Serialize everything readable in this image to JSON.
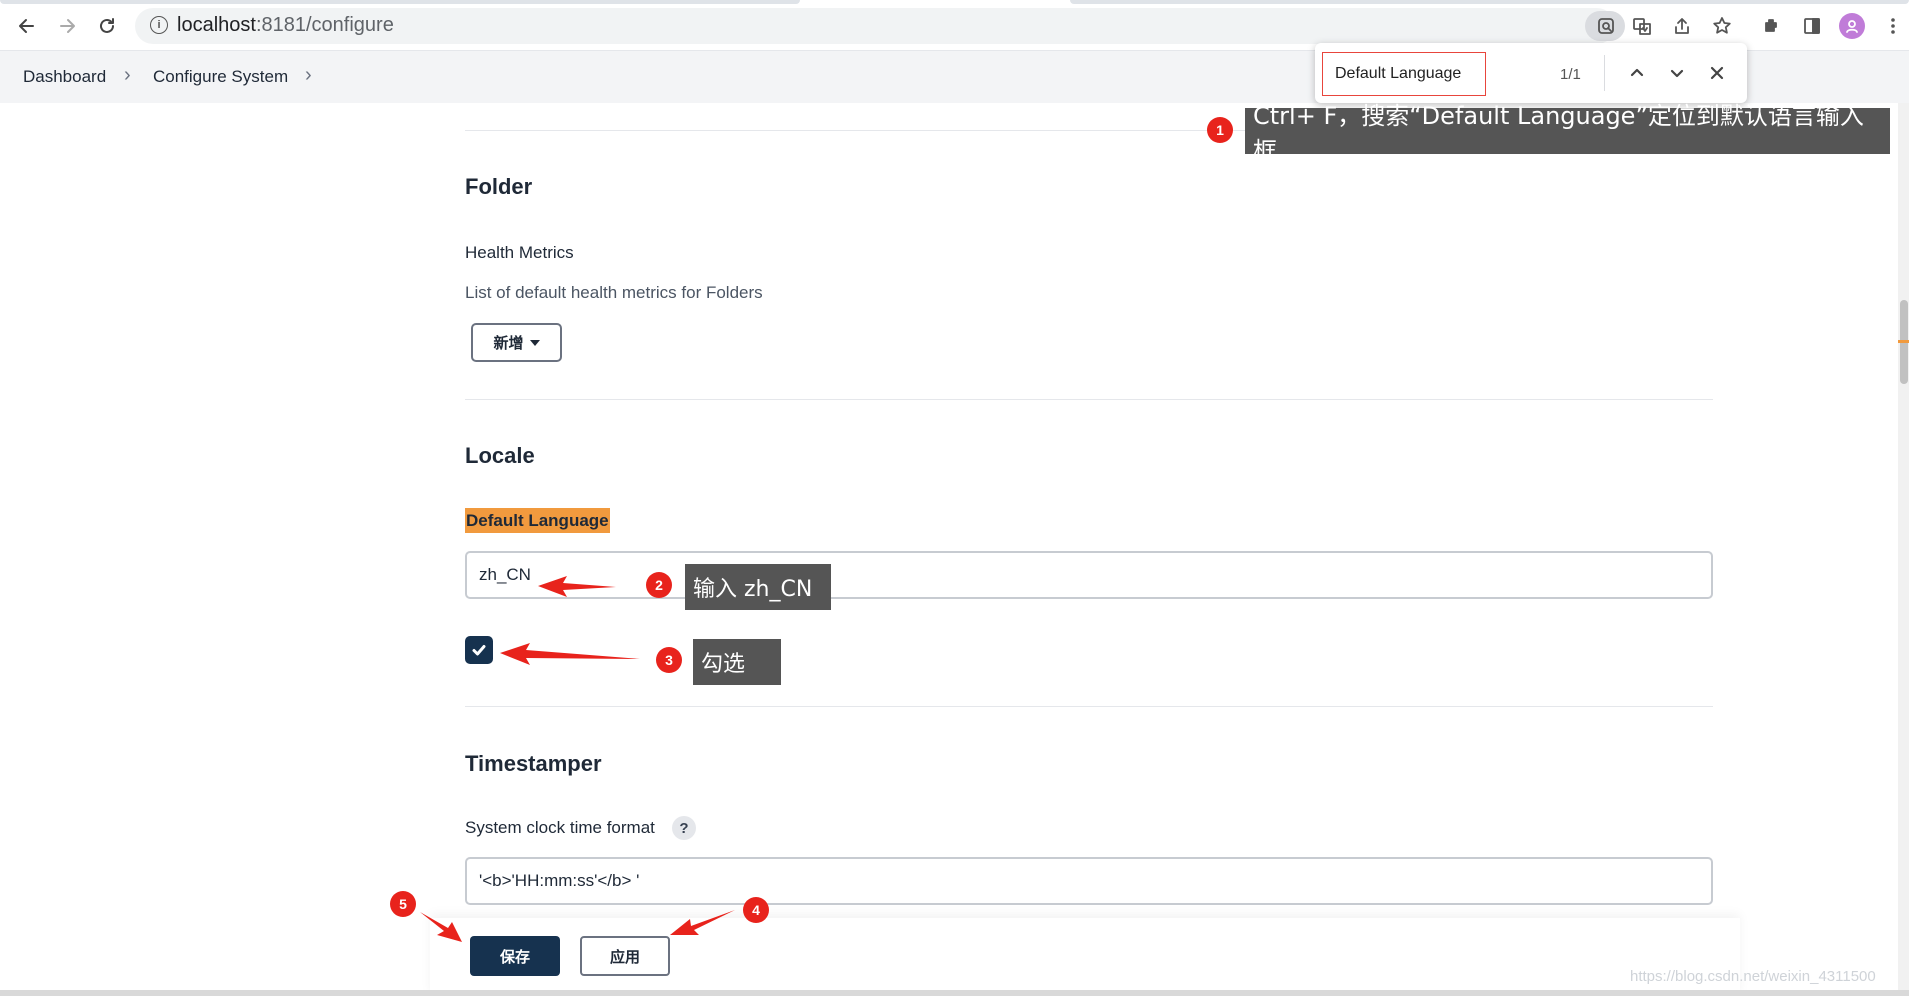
{
  "browser": {
    "url_host": "localhost",
    "url_rest": ":8181/configure",
    "find": {
      "query": "Default Language",
      "count": "1/1"
    }
  },
  "breadcrumb": {
    "items": [
      "Dashboard",
      "Configure System"
    ]
  },
  "folder": {
    "title": "Folder",
    "health_label": "Health Metrics",
    "health_desc": "List of default health metrics for Folders",
    "add_button": "新增"
  },
  "locale": {
    "title": "Locale",
    "default_language_label": "Default Language",
    "default_language_value": "zh_CN",
    "checkbox_checked": true
  },
  "timestamper": {
    "title": "Timestamper",
    "clock_label": "System clock time format",
    "help": "?",
    "clock_value": "'<b>'HH:mm:ss'</b> '"
  },
  "actions": {
    "save": "保存",
    "apply": "应用"
  },
  "annotations": {
    "step1_num": "1",
    "step1_text": "Ctrl+ F，搜索“Default Language”定位到默认语言输入框",
    "step2_num": "2",
    "step2_text": "输入 zh_CN",
    "step3_num": "3",
    "step3_text": "勾选",
    "step4_num": "4",
    "step5_num": "5"
  },
  "watermark": "https://blog.csdn.net/weixin_4311500",
  "colors": {
    "primary": "#16324f",
    "highlight": "#f19a3e",
    "annotation_red": "#e8231c",
    "callout_bg": "#555555"
  }
}
